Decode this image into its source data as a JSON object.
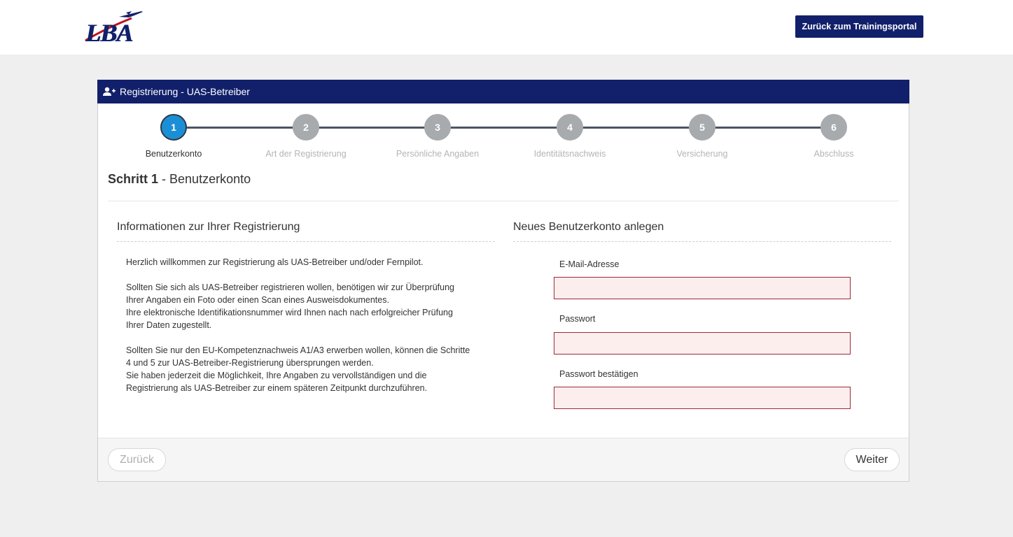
{
  "header": {
    "logo_text": "LBA",
    "portal_button": "Zurück zum Trainingsportal"
  },
  "panel": {
    "title": "Registrierung - UAS-Betreiber",
    "icon": "user-plus-icon"
  },
  "steps": [
    {
      "number": "1",
      "label": "Benutzerkonto",
      "active": true
    },
    {
      "number": "2",
      "label": "Art der Registrierung",
      "active": false
    },
    {
      "number": "3",
      "label": "Persönliche Angaben",
      "active": false
    },
    {
      "number": "4",
      "label": "Identitätsnachweis",
      "active": false
    },
    {
      "number": "5",
      "label": "Versicherung",
      "active": false
    },
    {
      "number": "6",
      "label": "Abschluss",
      "active": false
    }
  ],
  "step_heading": {
    "bold": "Schritt 1",
    "separator": " - ",
    "title": "Benutzerkonto"
  },
  "info": {
    "title": "Informationen zur Ihrer Registrierung",
    "paragraphs": [
      [
        "Herzlich willkommen zur Registrierung als UAS-Betreiber und/oder Fernpilot."
      ],
      [
        "Sollten Sie sich als UAS-Betreiber registrieren wollen, benötigen wir zur Überprüfung",
        "Ihrer Angaben ein Foto oder einen Scan eines Ausweisdokumentes.",
        "Ihre elektronische Identifikationsnummer wird Ihnen nach nach erfolgreicher Prüfung",
        "Ihrer Daten zugestellt."
      ],
      [
        "Sollten Sie nur den EU-Kompetenznachweis A1/A3 erwerben wollen, können die Schritte",
        "4 und 5 zur UAS-Betreiber-Registrierung übersprungen werden.",
        "Sie haben jederzeit die Möglichkeit, Ihre Angaben zu vervollständigen und die",
        "Registrierung als UAS-Betreiber zur einem späteren Zeitpunkt durchzuführen."
      ]
    ]
  },
  "form": {
    "title": "Neues Benutzerkonto anlegen",
    "email_label": "E-Mail-Adresse",
    "email_value": "",
    "password_label": "Passwort",
    "password_value": "",
    "confirm_label": "Passwort bestätigen",
    "confirm_value": ""
  },
  "footer": {
    "back_label": "Zurück",
    "next_label": "Weiter"
  },
  "colors": {
    "brand": "#12206b",
    "active_step": "#1b8fd6",
    "inactive_step": "#a8abae",
    "input_error_bg": "#fdeeee",
    "input_error_border": "#9b2b3b"
  }
}
